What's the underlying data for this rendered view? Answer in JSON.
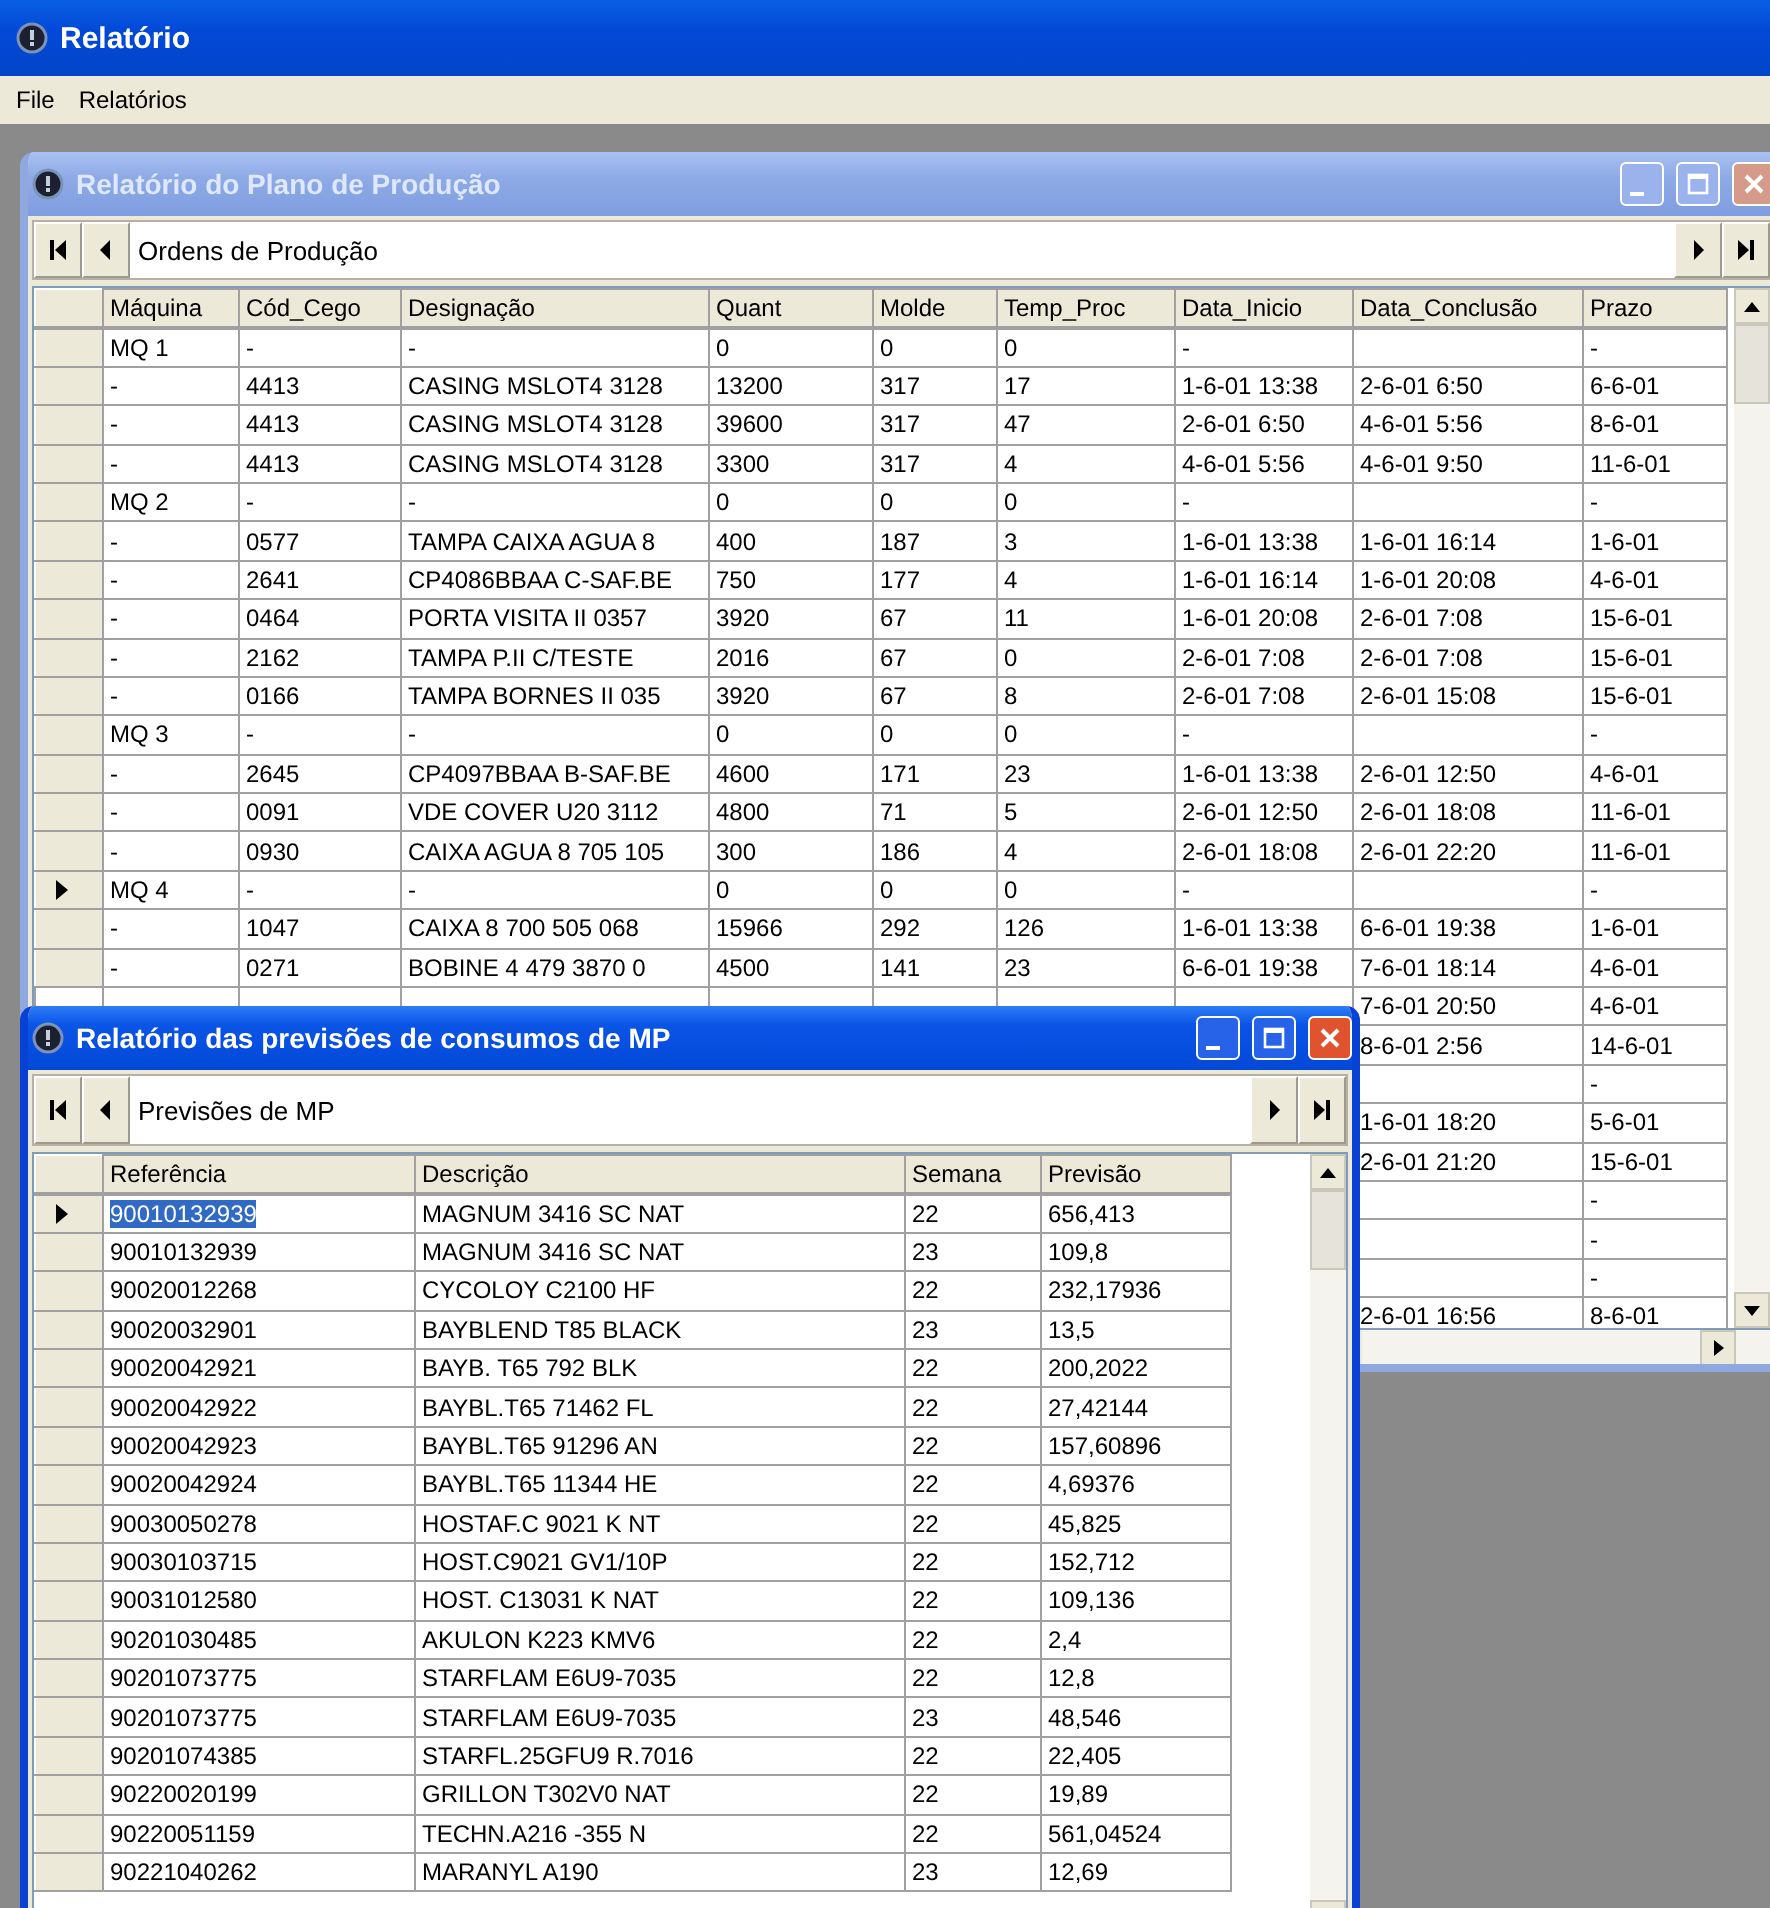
{
  "app": {
    "title": "Relatório"
  },
  "menu": [
    {
      "label": "File"
    },
    {
      "label": "Relatórios"
    }
  ],
  "child_windows": [
    {
      "title": "Relatório do Plano de Produção",
      "active": false,
      "navigator": {
        "label": "Ordens de Produção"
      },
      "table": {
        "columns": [
          "Máquina",
          "Cód_Cego",
          "Designação",
          "Quant",
          "Molde",
          "Temp_Proc",
          "Data_Inicio",
          "Data_Conclusão",
          "Prazo"
        ],
        "rows": [
          {
            "current": false,
            "cells": [
              "MQ 1",
              "-",
              "-",
              "0",
              "0",
              "0",
              "-",
              null,
              "-"
            ]
          },
          {
            "current": false,
            "cells": [
              "-",
              "4413",
              "CASING MSLOT4 3128",
              "13200",
              "317",
              "17",
              "1-6-01 13:38",
              "2-6-01 6:50",
              "6-6-01"
            ]
          },
          {
            "current": false,
            "cells": [
              "-",
              "4413",
              "CASING MSLOT4 3128",
              "39600",
              "317",
              "47",
              "2-6-01 6:50",
              "4-6-01 5:56",
              "8-6-01"
            ]
          },
          {
            "current": false,
            "cells": [
              "-",
              "4413",
              "CASING MSLOT4 3128",
              "3300",
              "317",
              "4",
              "4-6-01 5:56",
              "4-6-01 9:50",
              "11-6-01"
            ]
          },
          {
            "current": false,
            "cells": [
              "MQ 2",
              "-",
              "-",
              "0",
              "0",
              "0",
              "-",
              null,
              "-"
            ]
          },
          {
            "current": false,
            "cells": [
              "-",
              "0577",
              "TAMPA CAIXA AGUA 8",
              "400",
              "187",
              "3",
              "1-6-01 13:38",
              "1-6-01 16:14",
              "1-6-01"
            ]
          },
          {
            "current": false,
            "cells": [
              "-",
              "2641",
              "CP4086BBAA C-SAF.BE",
              "750",
              "177",
              "4",
              "1-6-01 16:14",
              "1-6-01 20:08",
              "4-6-01"
            ]
          },
          {
            "current": false,
            "cells": [
              "-",
              "0464",
              "PORTA VISITA II 0357",
              "3920",
              "67",
              "11",
              "1-6-01 20:08",
              "2-6-01 7:08",
              "15-6-01"
            ]
          },
          {
            "current": false,
            "cells": [
              "-",
              "2162",
              "TAMPA P.II C/TESTE",
              "2016",
              "67",
              "0",
              "2-6-01 7:08",
              "2-6-01 7:08",
              "15-6-01"
            ]
          },
          {
            "current": false,
            "cells": [
              "-",
              "0166",
              "TAMPA BORNES II 035",
              "3920",
              "67",
              "8",
              "2-6-01 7:08",
              "2-6-01 15:08",
              "15-6-01"
            ]
          },
          {
            "current": false,
            "cells": [
              "MQ 3",
              "-",
              "-",
              "0",
              "0",
              "0",
              "-",
              null,
              "-"
            ]
          },
          {
            "current": false,
            "cells": [
              "-",
              "2645",
              "CP4097BBAA B-SAF.BE",
              "4600",
              "171",
              "23",
              "1-6-01 13:38",
              "2-6-01 12:50",
              "4-6-01"
            ]
          },
          {
            "current": false,
            "cells": [
              "-",
              "0091",
              "VDE COVER U20 3112",
              "4800",
              "71",
              "5",
              "2-6-01 12:50",
              "2-6-01 18:08",
              "11-6-01"
            ]
          },
          {
            "current": false,
            "cells": [
              "-",
              "0930",
              "CAIXA AGUA 8 705 105",
              "300",
              "186",
              "4",
              "2-6-01 18:08",
              "2-6-01 22:20",
              "11-6-01"
            ]
          },
          {
            "current": true,
            "cells": [
              "MQ 4",
              "-",
              "-",
              "0",
              "0",
              "0",
              "-",
              null,
              "-"
            ]
          },
          {
            "current": false,
            "cells": [
              "-",
              "1047",
              "CAIXA 8 700 505 068",
              "15966",
              "292",
              "126",
              "1-6-01 13:38",
              "6-6-01 19:38",
              "1-6-01"
            ]
          },
          {
            "current": false,
            "cells": [
              "-",
              "0271",
              "BOBINE 4 479 3870 0",
              "4500",
              "141",
              "23",
              "6-6-01 19:38",
              "7-6-01 18:14",
              "4-6-01"
            ]
          },
          {
            "cells": [
              null,
              null,
              null,
              null,
              null,
              null,
              null,
              "7-6-01 20:50",
              "4-6-01"
            ]
          },
          {
            "cells": [
              null,
              null,
              null,
              null,
              null,
              null,
              null,
              "8-6-01 2:56",
              "14-6-01"
            ]
          },
          {
            "cells": [
              null,
              null,
              null,
              null,
              null,
              null,
              null,
              null,
              "-"
            ]
          },
          {
            "cells": [
              null,
              null,
              null,
              null,
              null,
              null,
              null,
              "1-6-01 18:20",
              "5-6-01"
            ]
          },
          {
            "cells": [
              null,
              null,
              null,
              null,
              null,
              null,
              null,
              "2-6-01 21:20",
              "15-6-01"
            ]
          },
          {
            "cells": [
              null,
              null,
              null,
              null,
              null,
              null,
              null,
              null,
              "-"
            ]
          },
          {
            "cells": [
              null,
              null,
              null,
              null,
              null,
              null,
              null,
              null,
              "-"
            ]
          },
          {
            "cells": [
              null,
              null,
              null,
              null,
              null,
              null,
              null,
              null,
              "-"
            ]
          },
          {
            "cells": [
              null,
              null,
              null,
              null,
              null,
              null,
              null,
              "2-6-01 16:56",
              "8-6-01"
            ]
          }
        ]
      }
    },
    {
      "title": "Relatório das previsões de consumos de MP",
      "active": true,
      "navigator": {
        "label": "Previsões de MP"
      },
      "table": {
        "columns": [
          "Referência",
          "Descrição",
          "Semana",
          "Previsão"
        ],
        "rows": [
          {
            "current": true,
            "cells": [
              "90010132939",
              "MAGNUM 3416 SC NAT",
              "22",
              "656,413"
            ]
          },
          {
            "current": false,
            "cells": [
              "90010132939",
              "MAGNUM 3416 SC NAT",
              "23",
              "109,8"
            ]
          },
          {
            "current": false,
            "cells": [
              "90020012268",
              "CYCOLOY C2100 HF",
              "22",
              "232,17936"
            ]
          },
          {
            "current": false,
            "cells": [
              "90020032901",
              "BAYBLEND T85 BLACK",
              "23",
              "13,5"
            ]
          },
          {
            "current": false,
            "cells": [
              "90020042921",
              "BAYB. T65 792 BLK",
              "22",
              "200,2022"
            ]
          },
          {
            "current": false,
            "cells": [
              "90020042922",
              "BAYBL.T65 71462 FL",
              "22",
              "27,42144"
            ]
          },
          {
            "current": false,
            "cells": [
              "90020042923",
              "BAYBL.T65 91296 AN",
              "22",
              "157,60896"
            ]
          },
          {
            "current": false,
            "cells": [
              "90020042924",
              "BAYBL.T65 11344 HE",
              "22",
              "4,69376"
            ]
          },
          {
            "current": false,
            "cells": [
              "90030050278",
              "HOSTAF.C 9021 K NT",
              "22",
              "45,825"
            ]
          },
          {
            "current": false,
            "cells": [
              "90030103715",
              "HOST.C9021 GV1/10P",
              "22",
              "152,712"
            ]
          },
          {
            "current": false,
            "cells": [
              "90031012580",
              "HOST. C13031 K NAT",
              "22",
              "109,136"
            ]
          },
          {
            "current": false,
            "cells": [
              "90201030485",
              "AKULON K223 KMV6",
              "22",
              "2,4"
            ]
          },
          {
            "current": false,
            "cells": [
              "90201073775",
              "STARFLAM E6U9-7035",
              "22",
              "12,8"
            ]
          },
          {
            "current": false,
            "cells": [
              "90201073775",
              "STARFLAM E6U9-7035",
              "23",
              "48,546"
            ]
          },
          {
            "current": false,
            "cells": [
              "90201074385",
              "STARFL.25GFU9 R.7016",
              "22",
              "22,405"
            ]
          },
          {
            "current": false,
            "cells": [
              "90220020199",
              "GRILLON T302V0 NAT",
              "22",
              "19,89"
            ]
          },
          {
            "current": false,
            "cells": [
              "90220051159",
              "TECHN.A216 -355 N",
              "22",
              "561,04524"
            ]
          },
          {
            "current": false,
            "cells": [
              "90221040262",
              "MARANYL A190",
              "23",
              "12,69"
            ]
          }
        ]
      }
    }
  ]
}
